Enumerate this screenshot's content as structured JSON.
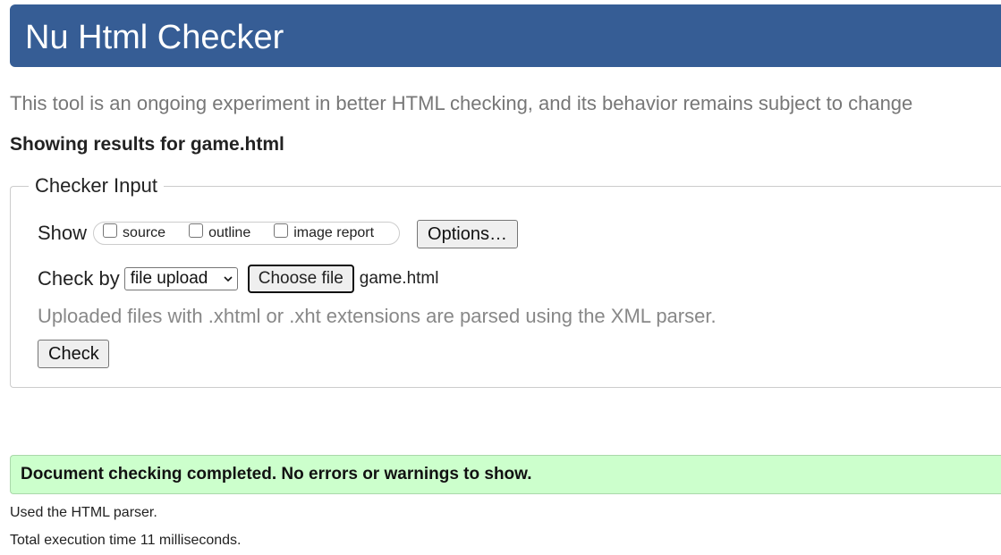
{
  "header": {
    "title": "Nu Html Checker"
  },
  "intro": "This tool is an ongoing experiment in better HTML checking, and its behavior remains subject to change",
  "showing_results": "Showing results for game.html",
  "checker_input": {
    "legend": "Checker Input",
    "show_label": "Show",
    "show_options": [
      {
        "label": "source",
        "checked": false
      },
      {
        "label": "outline",
        "checked": false
      },
      {
        "label": "image report",
        "checked": false
      }
    ],
    "options_button": "Options…",
    "check_by_label": "Check by",
    "check_by_select": "file upload",
    "choose_file_button": "Choose file",
    "chosen_file": "game.html",
    "hint": "Uploaded files with .xhtml or .xht extensions are parsed using the XML parser.",
    "check_button": "Check"
  },
  "result": {
    "message": "Document checking completed. No errors or warnings to show.",
    "parser_note": "Used the HTML parser.",
    "execution_time": "Total execution time 11 milliseconds."
  },
  "colors": {
    "header_bg": "#365d95",
    "success_bg": "#ccffcc"
  }
}
